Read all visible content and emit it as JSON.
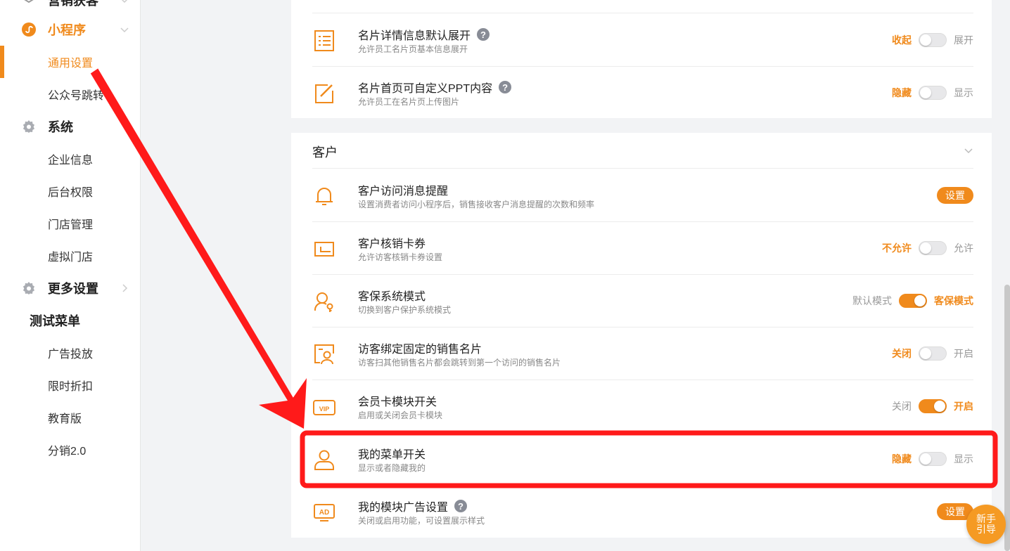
{
  "sidebar": {
    "top_partial_label": "营销获客",
    "mini_program": {
      "label": "小程序",
      "items": [
        "通用设置",
        "公众号跳转"
      ]
    },
    "system": {
      "label": "系统",
      "items": [
        "企业信息",
        "后台权限",
        "门店管理",
        "虚拟门店"
      ]
    },
    "more_settings": {
      "label": "更多设置"
    },
    "test_menu": {
      "label": "测试菜单",
      "items": [
        "广告投放",
        "限时折扣",
        "教育版",
        "分销2.0"
      ]
    }
  },
  "card_settings": {
    "rows": [
      {
        "title": "名片详情信息默认展开",
        "desc": "允许员工名片页基本信息展开",
        "left": "收起",
        "right": "展开",
        "on": false
      },
      {
        "title": "名片首页可自定义PPT内容",
        "desc": "允许员工在名片页上传图片",
        "left": "隐藏",
        "right": "显示",
        "on": false
      }
    ]
  },
  "customer": {
    "section_title": "客户",
    "rows": [
      {
        "title": "客户访问消息提醒",
        "desc": "设置消费者访问小程序后，销售接收客户消息提醒的次数和频率",
        "button": "设置"
      },
      {
        "title": "客户核销卡券",
        "desc": "允许访客核销卡券设置",
        "left": "不允许",
        "right": "允许",
        "on": false
      },
      {
        "title": "客保系统模式",
        "desc": "切换到客户保护系统模式",
        "left": "默认模式",
        "right": "客保模式",
        "on": true
      },
      {
        "title": "访客绑定固定的销售名片",
        "desc": "访客扫其他销售名片都会跳转到第一个访问的销售名片",
        "left": "关闭",
        "right": "开启",
        "on": false
      },
      {
        "title": "会员卡模块开关",
        "desc": "启用或关闭会员卡模块",
        "left": "关闭",
        "right": "开启",
        "on": true
      },
      {
        "title": "我的菜单开关",
        "desc": "显示或者隐藏我的",
        "left": "隐藏",
        "right": "显示",
        "on": false
      },
      {
        "title": "我的模块广告设置",
        "desc": "关闭或启用功能，可设置展示样式",
        "button": "设置"
      }
    ]
  },
  "help_mark": "?",
  "float_button": {
    "line1": "新手",
    "line2": "引导"
  },
  "icons": {
    "accent": "#f08a1c",
    "annotation": "#ff1a1a"
  }
}
